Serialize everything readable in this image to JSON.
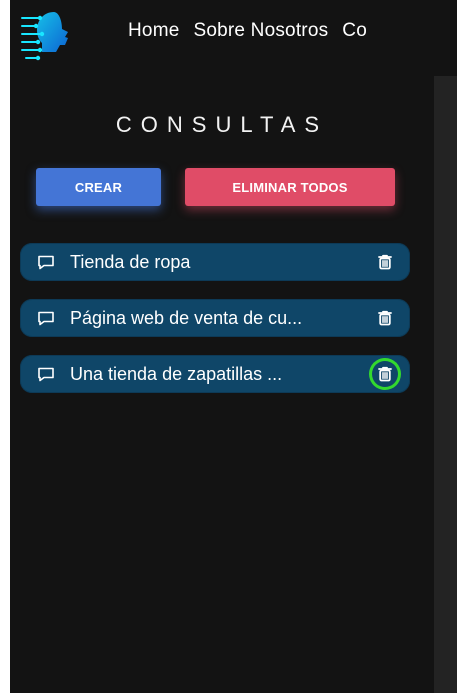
{
  "nav": {
    "items": [
      "Home",
      "Sobre Nosotros",
      "Co"
    ]
  },
  "sidebar": {
    "title": "CONSULTAS",
    "create_label": "CREAR",
    "delete_all_label": "ELIMINAR TODOS",
    "items": [
      {
        "label": "Tienda de ropa"
      },
      {
        "label": "Página web de venta de cu..."
      },
      {
        "label": "Una tienda de zapatillas ..."
      }
    ]
  },
  "colors": {
    "background": "#131313",
    "create_button": "#4475d6",
    "delete_all_button": "#e04c67",
    "list_item": "#0f4668",
    "highlight_ring": "#33d92e"
  },
  "icons": {
    "logo": "ai-brain-head-logo",
    "item": "chat-bubble-icon",
    "delete": "trash-icon"
  }
}
